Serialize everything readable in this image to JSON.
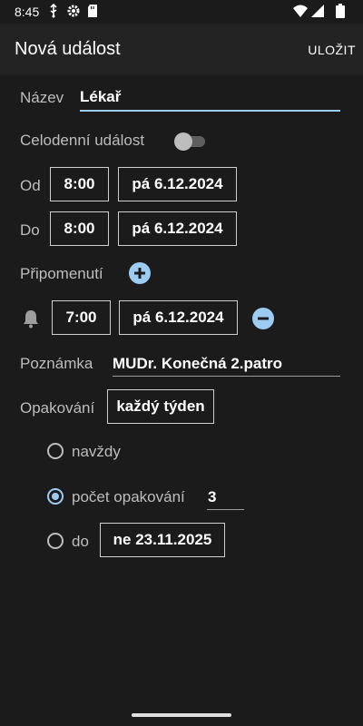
{
  "status": {
    "time": "8:45"
  },
  "appbar": {
    "title": "Nová událost",
    "save_label": "ULOŽIT"
  },
  "form": {
    "name_label": "Název",
    "name_value": "Lékař",
    "allday_label": "Celodenní událost",
    "allday_on": false,
    "from_label": "Od",
    "from_time": "8:00",
    "from_date": "pá 6.12.2024",
    "to_label": "Do",
    "to_time": "8:00",
    "to_date": "pá 6.12.2024",
    "reminders_label": "Připomenutí",
    "reminder_time": "7:00",
    "reminder_date": "pá 6.12.2024",
    "note_label": "Poznámka",
    "note_value": "MUDr. Konečná 2.patro",
    "repeat_label": "Opakování",
    "repeat_value": "každý týden",
    "repeat_options": {
      "forever": "navždy",
      "count_label": "počet opakování",
      "count_value": "3",
      "until_label": "do",
      "until_date": "ne 23.11.2025",
      "selected": "count"
    }
  },
  "colors": {
    "accent": "#9cccf2",
    "background": "#1b1b1b",
    "appbar": "#232323"
  }
}
